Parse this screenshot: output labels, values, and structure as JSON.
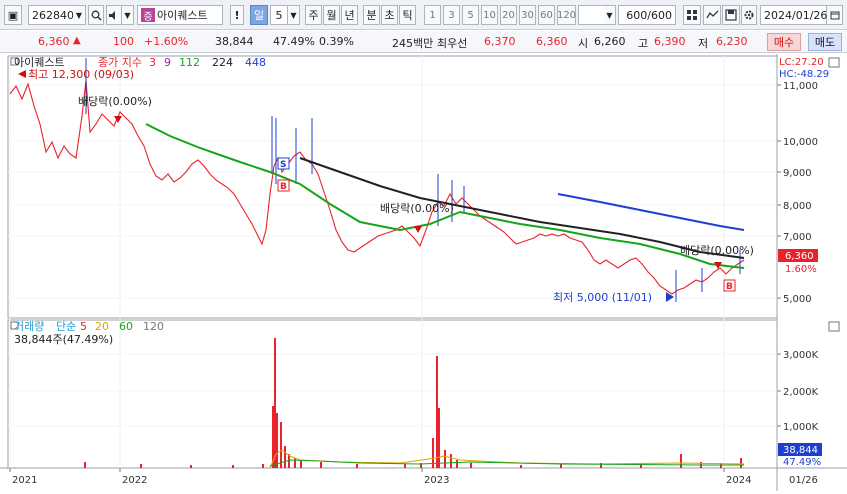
{
  "toolbar": {
    "stock_code": "262840",
    "stock_badge": "증",
    "stock_name": "아이퀘스트",
    "warn_label": "!",
    "period_label": "일",
    "period_value": "5",
    "timeframes": [
      "주",
      "월",
      "년",
      "분",
      "초",
      "틱"
    ],
    "numbers": [
      "1",
      "3",
      "5",
      "10",
      "20",
      "30",
      "60",
      "120"
    ],
    "count_value": "600",
    "count_total": "/600",
    "date": "2024/01/26"
  },
  "quote": {
    "price": "6,360",
    "arrow": "▲",
    "change": "100",
    "change_pct": "+1.60%",
    "volume": "38,844",
    "vol_ratio": "47.49%",
    "turnover": "0.39%",
    "trade_value": "245백만",
    "ask_label": "최우선",
    "ask": "6,370",
    "bid": "6,360",
    "open_label": "시",
    "open": "6,260",
    "high_label": "고",
    "high": "6,390",
    "low_label": "저",
    "low": "6,230",
    "buy_label": "매수",
    "sell_label": "매도"
  },
  "price_panel": {
    "title": "아이퀘스트",
    "legend": [
      {
        "label": "종가 지수",
        "color": "#e8232b"
      },
      {
        "label": "3",
        "color": "#e8232b"
      },
      {
        "label": "9",
        "color": "#9b1fbf"
      },
      {
        "label": "112",
        "color": "#18a418"
      },
      {
        "label": "224",
        "color": "#222222"
      },
      {
        "label": "448",
        "color": "#1f3fd0"
      }
    ],
    "high_note": "최고 12,300 (09/03)",
    "low_note": "최저 5,000 (11/01)",
    "dividend_label": "배당락(0.00%)",
    "lc": "LC:27.20",
    "hc": "HC:-48.29",
    "current_price": "6,360",
    "current_pct": "1.60%"
  },
  "volume_panel": {
    "title": "거래량",
    "legend": [
      {
        "label": "단순",
        "color": "#20a0d8"
      },
      {
        "label": "5",
        "color": "#e8232b"
      },
      {
        "label": "20",
        "color": "#d8a800"
      },
      {
        "label": "60",
        "color": "#18a418"
      },
      {
        "label": "120",
        "color": "#7a7a7a"
      }
    ],
    "current": "38,844주(47.49%)",
    "tag_value": "38,844",
    "tag_pct": "47.49%"
  },
  "axis": {
    "price_ticks": [
      "11,000",
      "10,000",
      "9,000",
      "8,000",
      "7,000",
      "5,000"
    ],
    "volume_ticks": [
      "3,000K",
      "2,000K",
      "1,000K"
    ],
    "date_ticks": [
      "2021",
      "2022",
      "2023",
      "2024"
    ],
    "date_right": "01/26"
  },
  "colors": {
    "up": "#e8232b",
    "down": "#1f3fd0",
    "ma112": "#18a418",
    "ma224": "#222222",
    "ma448": "#1f3fd0"
  }
}
